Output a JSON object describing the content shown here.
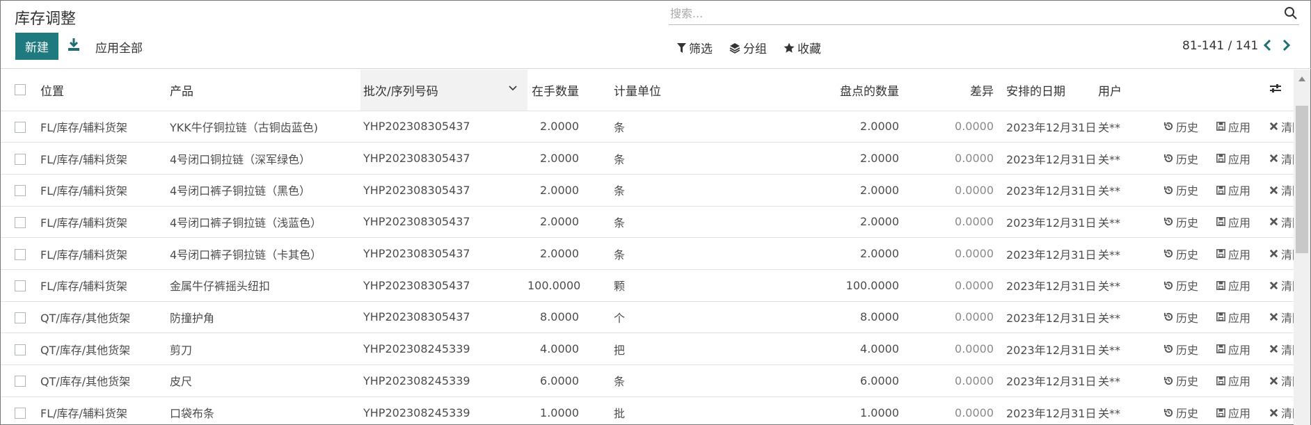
{
  "header": {
    "title": "库存调整",
    "new_label": "新建",
    "apply_all_label": "应用全部",
    "search_placeholder": "搜索...",
    "filter_label": "筛选",
    "group_label": "分组",
    "favorite_label": "收藏",
    "pager": "81-141 / 141"
  },
  "columns": {
    "location": "位置",
    "product": "产品",
    "lot": "批次/序列号码",
    "on_hand": "在手数量",
    "uom": "计量单位",
    "counted": "盘点的数量",
    "diff": "差异",
    "date": "安排的日期",
    "user": "用户"
  },
  "actions": {
    "history": "历史",
    "apply": "应用",
    "clear": "清除"
  },
  "rows": [
    {
      "location": "FL/库存/辅料货架",
      "product": "YKK牛仔铜拉链（古铜齿蓝色)",
      "lot": "YHP202308305437",
      "on_hand": "2.0000",
      "uom": "条",
      "counted": "2.0000",
      "diff": "0.0000",
      "date": "2023年12月31日",
      "user": "关**"
    },
    {
      "location": "FL/库存/辅料货架",
      "product": "4号闭口铜拉链（深军绿色）",
      "lot": "YHP202308305437",
      "on_hand": "2.0000",
      "uom": "条",
      "counted": "2.0000",
      "diff": "0.0000",
      "date": "2023年12月31日",
      "user": "关**"
    },
    {
      "location": "FL/库存/辅料货架",
      "product": "4号闭口裤子铜拉链（黑色）",
      "lot": "YHP202308305437",
      "on_hand": "2.0000",
      "uom": "条",
      "counted": "2.0000",
      "diff": "0.0000",
      "date": "2023年12月31日",
      "user": "关**"
    },
    {
      "location": "FL/库存/辅料货架",
      "product": "4号闭口裤子铜拉链（浅蓝色）",
      "lot": "YHP202308305437",
      "on_hand": "2.0000",
      "uom": "条",
      "counted": "2.0000",
      "diff": "0.0000",
      "date": "2023年12月31日",
      "user": "关**"
    },
    {
      "location": "FL/库存/辅料货架",
      "product": "4号闭口裤子铜拉链（卡其色）",
      "lot": "YHP202308305437",
      "on_hand": "2.0000",
      "uom": "条",
      "counted": "2.0000",
      "diff": "0.0000",
      "date": "2023年12月31日",
      "user": "关**"
    },
    {
      "location": "FL/库存/辅料货架",
      "product": "金属牛仔裤摇头纽扣",
      "lot": "YHP202308305437",
      "on_hand": "100.0000",
      "uom": "颗",
      "counted": "100.0000",
      "diff": "0.0000",
      "date": "2023年12月31日",
      "user": "关**"
    },
    {
      "location": "QT/库存/其他货架",
      "product": "防撞护角",
      "lot": "YHP202308305437",
      "on_hand": "8.0000",
      "uom": "个",
      "counted": "8.0000",
      "diff": "0.0000",
      "date": "2023年12月31日",
      "user": "关**"
    },
    {
      "location": "QT/库存/其他货架",
      "product": "剪刀",
      "lot": "YHP202308245339",
      "on_hand": "4.0000",
      "uom": "把",
      "counted": "4.0000",
      "diff": "0.0000",
      "date": "2023年12月31日",
      "user": "关**"
    },
    {
      "location": "QT/库存/其他货架",
      "product": "皮尺",
      "lot": "YHP202308245339",
      "on_hand": "6.0000",
      "uom": "条",
      "counted": "6.0000",
      "diff": "0.0000",
      "date": "2023年12月31日",
      "user": "关**"
    },
    {
      "location": "FL/库存/辅料货架",
      "product": "口袋布条",
      "lot": "YHP202308245339",
      "on_hand": "1.0000",
      "uom": "批",
      "counted": "1.0000",
      "diff": "0.0000",
      "date": "2023年12月31日",
      "user": "关**"
    }
  ]
}
